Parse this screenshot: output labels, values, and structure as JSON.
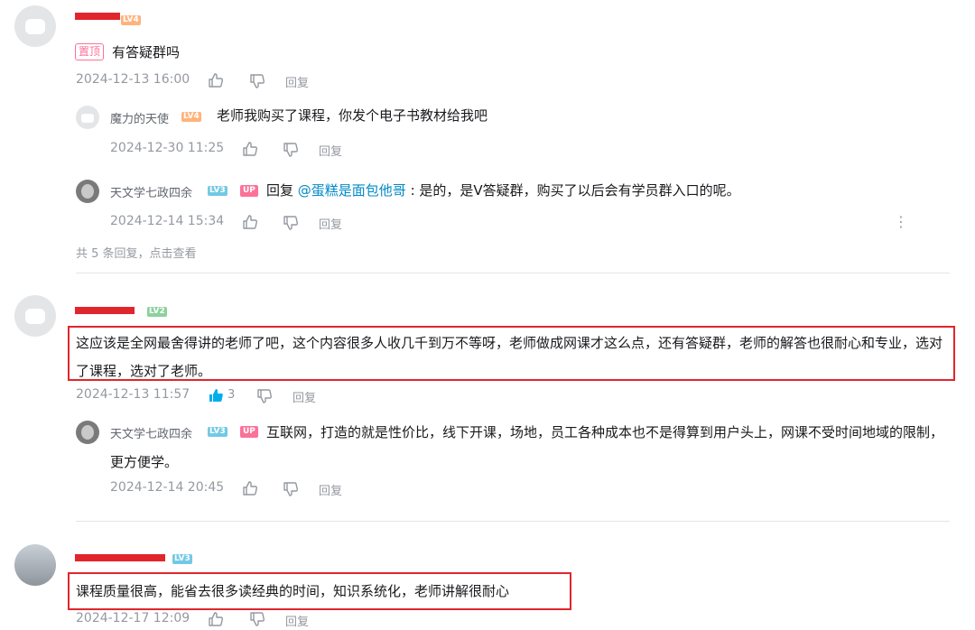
{
  "comments": [
    {
      "pinned_label": "置顶",
      "level": "LV4",
      "text": "有答疑群吗",
      "time": "2024-12-13 16:00",
      "reply_label": "回复",
      "replies": [
        {
          "user": "魔力的天使",
          "level": "LV4",
          "text": "老师我购买了课程，你发个电子书教材给我吧",
          "time": "2024-12-30 11:25",
          "reply_label": "回复"
        },
        {
          "user": "天文学七政四余",
          "level": "LV3",
          "up_label": "UP",
          "reply_prefix": "回复",
          "mention": "@蛋糕是面包他哥",
          "text": " : 是的，是V答疑群，购买了以后会有学员群入口的呢。",
          "time": "2024-12-14 15:34",
          "reply_label": "回复"
        }
      ],
      "more_replies": "共 5 条回复，点击查看"
    },
    {
      "level": "LV2",
      "text": "这应该是全网最舍得讲的老师了吧，这个内容很多人收几千到万不等呀，老师做成网课才这么点，还有答疑群，老师的解答也很耐心和专业，选对了课程，选对了老师。",
      "time": "2024-12-13 11:57",
      "like_count": "3",
      "reply_label": "回复",
      "replies": [
        {
          "user": "天文学七政四余",
          "level": "LV3",
          "up_label": "UP",
          "text": "互联网，打造的就是性价比，线下开课，场地，员工各种成本也不是得算到用户头上，网课不受时间地域的限制，更方便学。",
          "time": "2024-12-14 20:45",
          "reply_label": "回复"
        }
      ]
    },
    {
      "level": "LV3",
      "text": "课程质量很高，能省去很多读经典的时间，知识系统化，老师讲解很耐心",
      "time": "2024-12-17 12:09",
      "reply_label": "回复"
    }
  ],
  "icons": {
    "like": "thumbs-up-icon",
    "dislike": "thumbs-down-icon",
    "more": "more-vertical-icon",
    "avatar": "tv-mascot-avatar"
  },
  "colors": {
    "highlight_border": "#e0262c",
    "like_active": "#00aeec",
    "mention": "#008ac5",
    "up_badge": "#fb7299"
  }
}
